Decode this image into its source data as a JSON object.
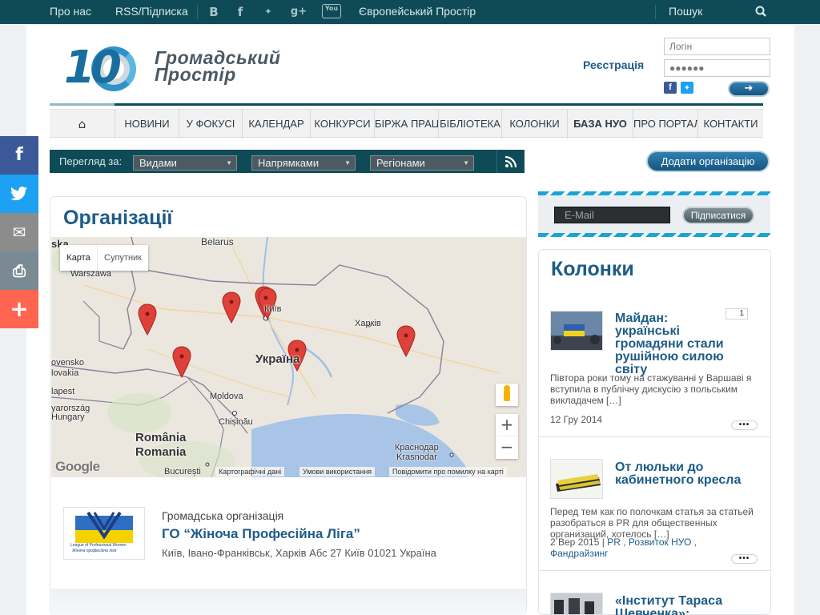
{
  "topbar": {
    "about": "Про нас",
    "rss": "RSS/Підписка",
    "social": [
      {
        "icon": "vk-icon",
        "glyph": "B"
      },
      {
        "icon": "facebook-icon",
        "glyph": "f"
      },
      {
        "icon": "twitter-icon",
        "glyph": "✦"
      },
      {
        "icon": "google-plus-icon",
        "glyph": "g+"
      },
      {
        "icon": "youtube-icon",
        "glyph": "You"
      }
    ],
    "euro": "Європейський Простір",
    "search": "Пошук",
    "search_icon": "search-icon"
  },
  "logo": {
    "number": "10",
    "line1": "Громадський",
    "line2": "Простір"
  },
  "login": {
    "register": "Реєстрація",
    "login_placeholder": "Логін",
    "password_value": "●●●●●●",
    "submit_icon": "arrow-right-icon"
  },
  "nav": {
    "home_icon": "home-icon",
    "items": [
      "НОВИНИ",
      "У ФОКУСІ",
      "КАЛЕНДАР",
      "КОНКУРСИ",
      "БІРЖА ПРАЦІ",
      "БІБЛІОТЕКА",
      "КОЛОНКИ",
      "БАЗА НУО",
      "ПРО ПОРТАЛ",
      "КОНТАКТИ"
    ],
    "active": "БАЗА НУО"
  },
  "filter": {
    "label": "Перегляд за:",
    "selects": [
      "Видами",
      "Напрямками",
      "Регіонами"
    ],
    "rss_icon": "rss-icon",
    "add_org": "Додати організацію"
  },
  "orgs": {
    "title": "Організації",
    "map": {
      "tab_map": "Карта",
      "tab_sat": "Супутник",
      "labels": {
        "belarus": "Belarus",
        "warszawa": "Warszawa",
        "ska": "ska",
        "kyiv": "Київ",
        "ukraine": "Україна",
        "kharkiv": "Харків",
        "slovensko": "ovensko",
        "slovakia": "lovakia",
        "budapest": "lapest",
        "magyarorszag": "yarország",
        "hungary": "Hungary",
        "moldova": "Moldova",
        "chisinau": "Chișinău",
        "romania1": "România",
        "romania2": "Romania",
        "bucuresti": "București",
        "krasnodar1": "Краснодар",
        "krasnodar2": "Krasnodar"
      },
      "footer": [
        "Картографічні дані",
        "Умови використання",
        "Повідомити про помилку на карті"
      ],
      "zoom_in": "+",
      "zoom_out": "−",
      "google": "Google"
    },
    "entry": {
      "type": "Громадська організація",
      "name": "ГО “Жіноча Професійна Ліга”",
      "address": "Київ, Івано-Франківськ, Харків Абс 27 Київ 01021 Україна",
      "logo_caption1": "League of Professional Women",
      "logo_caption2": "Жіноча професійна ліга"
    }
  },
  "share": [
    {
      "icon": "facebook-icon",
      "glyph": "f",
      "color": "#3b5998"
    },
    {
      "icon": "twitter-icon",
      "glyph": "🐦",
      "color": "#1da1f2"
    },
    {
      "icon": "email-icon",
      "glyph": "✉",
      "color": "#8c8c8c"
    },
    {
      "icon": "print-icon",
      "glyph": "⎙",
      "color": "#7a8a95"
    },
    {
      "icon": "plus-icon",
      "glyph": "+",
      "color": "#ff6550"
    }
  ],
  "subscribe": {
    "email_placeholder": "E-Mail",
    "button": "Підписатися"
  },
  "columns": {
    "title": "Колонки",
    "posts": [
      {
        "title": "Майдан: українські громадяни стали рушійною силою світу",
        "comments": "1",
        "excerpt": "Півтора роки тому на стажуванні у Варшаві я вступила в публічну дискусію з польським викладачем […]",
        "date": "12 Гру 2014",
        "more": "•••"
      },
      {
        "title": "От люльки до кабинетного кресла",
        "excerpt": "Перед тем как по полочкам статья за статьей разобраться в PR для общественных организаций, хотелось […]",
        "date": "2 Вер 2015",
        "sep": " | ",
        "tags": [
          "PR",
          "Розвиток НУО",
          "Фандрайзинг"
        ],
        "more": "•••"
      },
      {
        "title": "«Інститут Тараса Шевченка»:"
      }
    ]
  },
  "colors": {
    "topbar": "#0f4b57",
    "accent": "#1d5c87",
    "button": "#16557f",
    "marker": "#e0403a"
  }
}
